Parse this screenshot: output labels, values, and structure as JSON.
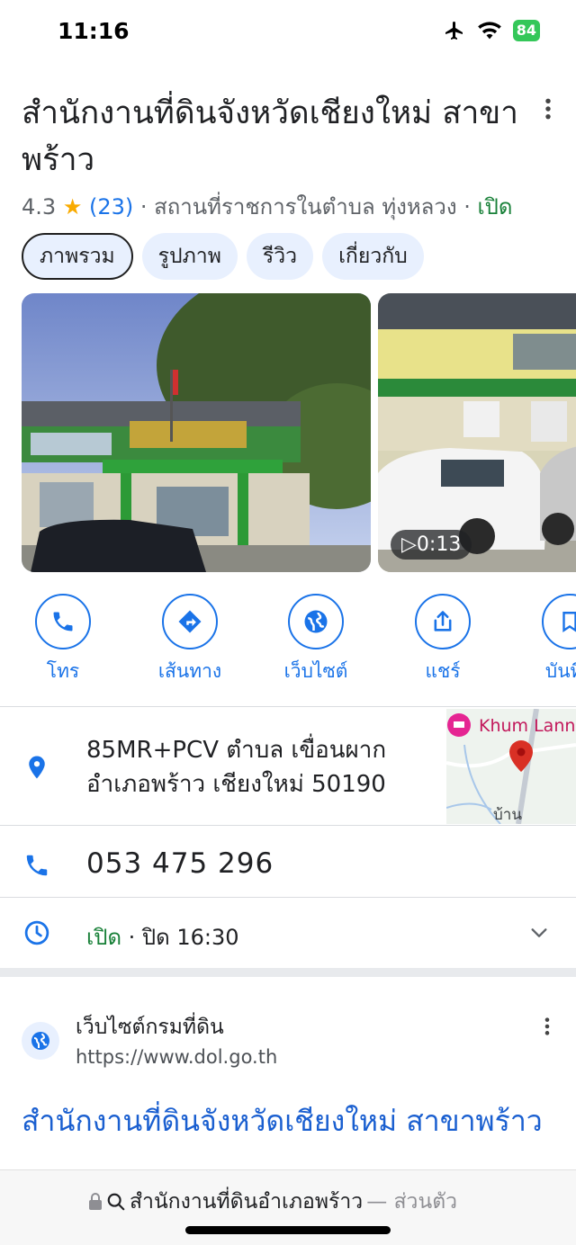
{
  "status": {
    "time": "11:16",
    "battery": "84"
  },
  "place": {
    "title": "สำนักงานที่ดินจังหวัดเชียงใหม่ สาขาพร้าว",
    "rating": "4.3",
    "reviews": "(23)",
    "category": " · สถานที่ราชการในตำบล ทุ่งหลวง · ",
    "open_status": "เปิด"
  },
  "tabs": [
    "ภาพรวม",
    "รูปภาพ",
    "รีวิว",
    "เกี่ยวกับ"
  ],
  "photos": {
    "video_duration": "0:13"
  },
  "actions": [
    "โทร",
    "เส้นทาง",
    "เว็บไซต์",
    "แชร์",
    "บันทึก"
  ],
  "info": {
    "address_line1": "85MR+PCV ตำบล เขื่อนผาก",
    "address_line2": "อำเภอพร้าว เชียงใหม่ 50190",
    "map_label": "Khum Lann",
    "map_label2": "บ้าน",
    "phone": "053 475 296",
    "hours_open": "เปิด",
    "hours_close": " · ปิด 16:30"
  },
  "web_result": {
    "site_name": "เว็บไซต์กรมที่ดิน",
    "url": "https://www.dol.go.th",
    "title": "สำนักงานที่ดินจังหวัดเชียงใหม่ สาขาพร้าว"
  },
  "browser": {
    "query": "สำนักงานที่ดินอำเภอพร้าว",
    "mode": " — ส่วนตัว"
  },
  "colors": {
    "accent": "#1a73e8",
    "open": "#188038",
    "star": "#f9ab00"
  }
}
